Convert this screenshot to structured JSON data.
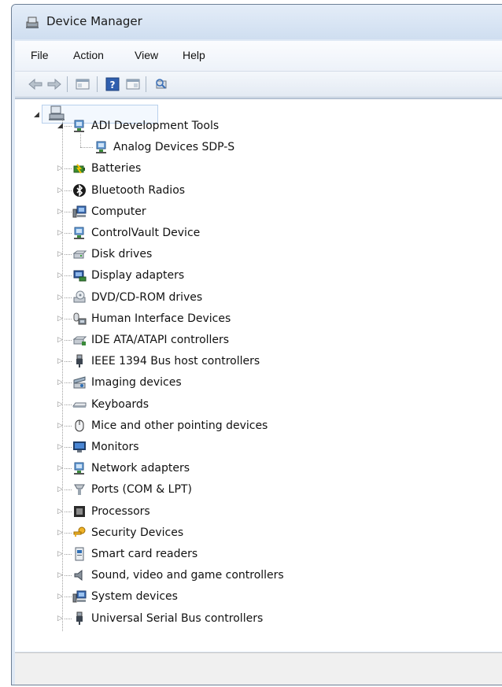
{
  "window": {
    "title": "Device Manager"
  },
  "menu": [
    "File",
    "Action",
    "View",
    "Help"
  ],
  "toolbar": [
    "back-icon",
    "forward-icon",
    "show-hide-console-tree-icon",
    "help-icon",
    "properties-icon",
    "scan-hardware-icon"
  ],
  "tree": {
    "root_label": "",
    "children": [
      {
        "label": "ADI Development Tools",
        "expanded": true,
        "icon": "network-device-icon",
        "children": [
          {
            "label": "Analog Devices SDP-S",
            "icon": "network-device-icon"
          }
        ]
      },
      {
        "label": "Batteries",
        "icon": "battery-icon"
      },
      {
        "label": "Bluetooth Radios",
        "icon": "bluetooth-icon"
      },
      {
        "label": "Computer",
        "icon": "computer-icon"
      },
      {
        "label": "ControlVault Device",
        "icon": "network-device-icon"
      },
      {
        "label": "Disk drives",
        "icon": "disk-drive-icon"
      },
      {
        "label": "Display adapters",
        "icon": "display-adapter-icon"
      },
      {
        "label": "DVD/CD-ROM drives",
        "icon": "dvd-drive-icon"
      },
      {
        "label": "Human Interface Devices",
        "icon": "hid-icon"
      },
      {
        "label": "IDE ATA/ATAPI controllers",
        "icon": "ide-controller-icon"
      },
      {
        "label": "IEEE 1394 Bus host controllers",
        "icon": "usb-plug-icon"
      },
      {
        "label": "Imaging devices",
        "icon": "scanner-icon"
      },
      {
        "label": "Keyboards",
        "icon": "keyboard-icon"
      },
      {
        "label": "Mice and other pointing devices",
        "icon": "mouse-icon"
      },
      {
        "label": "Monitors",
        "icon": "monitor-icon"
      },
      {
        "label": "Network adapters",
        "icon": "network-device-icon"
      },
      {
        "label": "Ports (COM & LPT)",
        "icon": "port-icon"
      },
      {
        "label": "Processors",
        "icon": "processor-icon"
      },
      {
        "label": "Security Devices",
        "icon": "key-icon"
      },
      {
        "label": "Smart card readers",
        "icon": "smart-card-icon"
      },
      {
        "label": "Sound, video and game controllers",
        "icon": "speaker-icon"
      },
      {
        "label": "System devices",
        "icon": "computer-icon"
      },
      {
        "label": "Universal Serial Bus controllers",
        "icon": "usb-plug-icon"
      }
    ]
  },
  "status": {
    "text": ""
  }
}
